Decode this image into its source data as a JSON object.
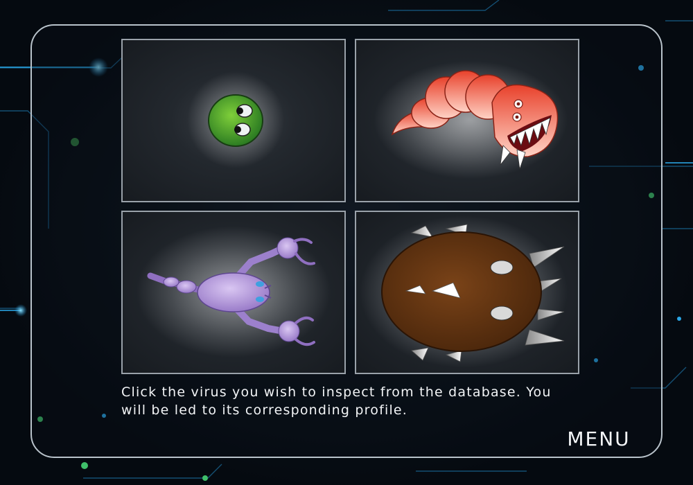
{
  "screen": "virus-database",
  "viruses": [
    {
      "id": "green-blob",
      "color": "#3f9a2b"
    },
    {
      "id": "red-worm",
      "color": "#e8553a"
    },
    {
      "id": "purple-scorpion",
      "color": "#b49ad8"
    },
    {
      "id": "brown-spiked",
      "color": "#6e3a14"
    }
  ],
  "instructions": "Click the virus you wish to inspect from the database.  You will be led to its corresponding profile.",
  "menu_label": "MENU"
}
